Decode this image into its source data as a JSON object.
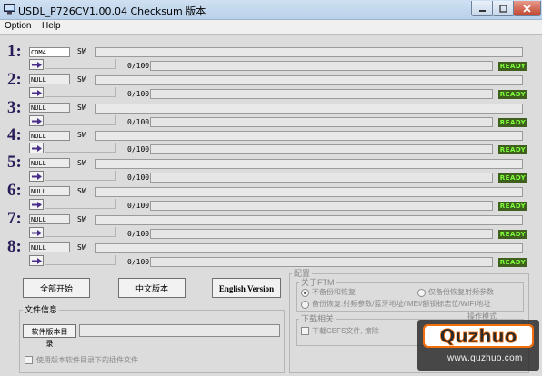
{
  "window": {
    "title": "USDL_P726CV1.00.04 Checksum 版本"
  },
  "menu": [
    "Option",
    "Help"
  ],
  "ports": [
    {
      "number": "1:",
      "name": "COM4",
      "sw_label": "SW",
      "progress": "0/100",
      "status": "READY"
    },
    {
      "number": "2:",
      "name": "NULL",
      "sw_label": "SW",
      "progress": "0/100",
      "status": "READY"
    },
    {
      "number": "3:",
      "name": "NULL",
      "sw_label": "SW",
      "progress": "0/100",
      "status": "READY"
    },
    {
      "number": "4:",
      "name": "NULL",
      "sw_label": "SW",
      "progress": "0/100",
      "status": "READY"
    },
    {
      "number": "5:",
      "name": "NULL",
      "sw_label": "SW",
      "progress": "0/100",
      "status": "READY"
    },
    {
      "number": "6:",
      "name": "NULL",
      "sw_label": "SW",
      "progress": "0/100",
      "status": "READY"
    },
    {
      "number": "7:",
      "name": "NULL",
      "sw_label": "SW",
      "progress": "0/100",
      "status": "READY"
    },
    {
      "number": "8:",
      "name": "NULL",
      "sw_label": "SW",
      "progress": "0/100",
      "status": "READY"
    }
  ],
  "buttons": {
    "start_all": "全部开始",
    "chinese": "中文版本",
    "english": "English Version"
  },
  "file_info": {
    "group_label": "文件信息",
    "browse_button": "软件版本目录",
    "path_value": "",
    "plugin_check_label": "使用版本软件目录下的插件文件"
  },
  "config": {
    "group_label": "配置",
    "ftm_group_label": "关于FTM",
    "options": [
      {
        "label": "不备份和恢复",
        "selected": true
      },
      {
        "label": "仅备份恢复射频参数",
        "selected": false
      },
      {
        "label": "备份恢复:射频参数/蓝牙地址/IMEI/额锁标志位/WIFI地址",
        "selected": false
      }
    ],
    "download_group_label": "下载相关",
    "cefs_check_label": "下载CEFS文件, 擦除",
    "partial_label": "操作模式"
  },
  "watermark": {
    "logo": "Quzhuo",
    "url": "www.quzhuo.com"
  },
  "colors": {
    "status_bg": "#3f5f1d",
    "status_text": "#7cff3a",
    "port_number": "#2a1c58"
  }
}
